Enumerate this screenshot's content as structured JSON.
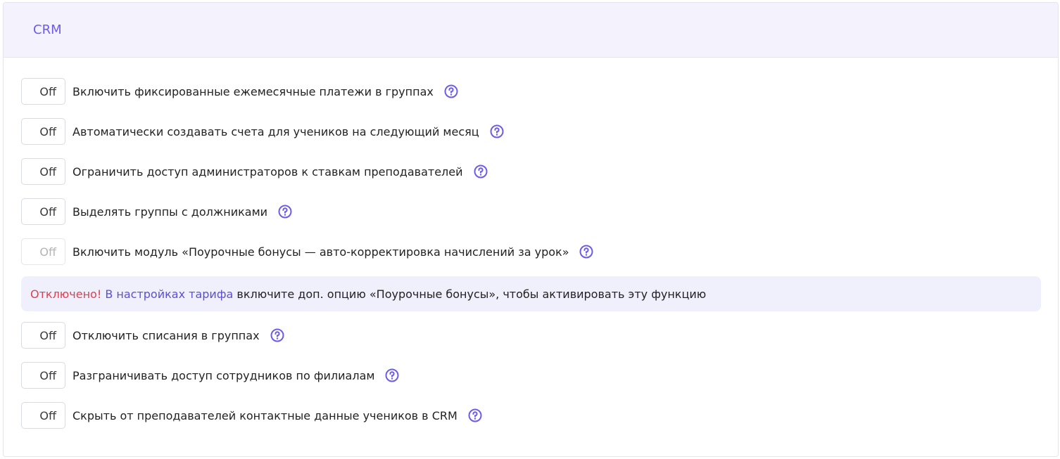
{
  "panel": {
    "title": "CRM"
  },
  "settings": [
    {
      "state": "Off",
      "label": "Включить фиксированные ежемесячные платежи в группах",
      "help_icon": "question-circle-icon"
    },
    {
      "state": "Off",
      "label": "Автоматически создавать счета для учеников на следующий месяц",
      "help_icon": "question-circle-icon"
    },
    {
      "state": "Off",
      "label": "Ограничить доступ администраторов к ставкам преподавателей",
      "help_icon": "question-circle-icon"
    },
    {
      "state": "Off",
      "label": "Выделять группы с должниками",
      "help_icon": "question-circle-icon"
    },
    {
      "state": "Off",
      "label": "Включить модуль «Поурочные бонусы — авто-корректировка начислений за урок»",
      "help_icon": "question-circle-icon",
      "disabled": true
    },
    {
      "state": "Off",
      "label": "Отключить списания в группах",
      "help_icon": "question-circle-icon"
    },
    {
      "state": "Off",
      "label": "Разграничивать доступ сотрудников по филиалам",
      "help_icon": "question-circle-icon"
    },
    {
      "state": "Off",
      "label": "Скрыть от преподавателей контактные данные учеников в CRM",
      "help_icon": "question-circle-icon"
    }
  ],
  "alert": {
    "prefix": "Отключено!",
    "link": "В настройках тарифа",
    "text": "включите доп. опцию «Поурочные бонусы», чтобы активировать эту функцию"
  },
  "colors": {
    "accent": "#6c5ce7",
    "header_bg": "#f3f2fd",
    "alert_bg": "#f0effc",
    "warning": "#e04050"
  }
}
